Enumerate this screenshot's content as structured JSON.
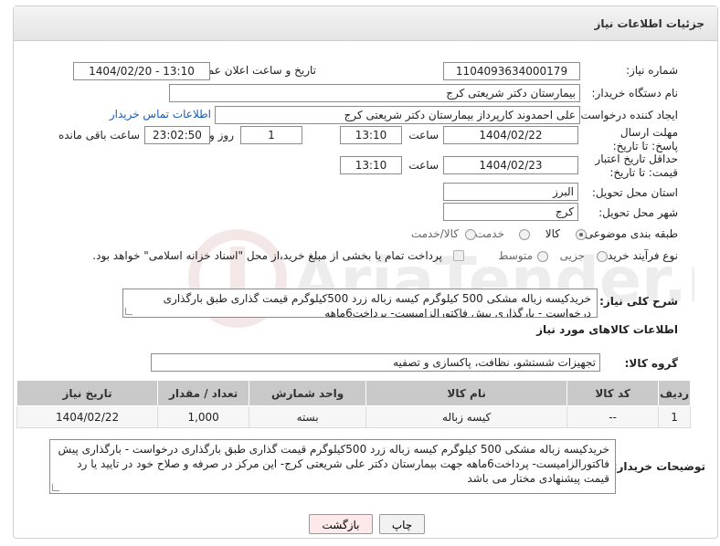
{
  "header": {
    "title": "جزئیات اطلاعات نیاز"
  },
  "form": {
    "need_number_label": "شماره نیاز:",
    "need_number": "1104093634000179",
    "announce_label": "تاریخ و ساعت اعلان عمومی:",
    "announce_value": "1404/02/20 - 13:10",
    "buyer_org_label": "نام دستگاه خریدار:",
    "buyer_org": "بیمارستان دکتر شریعتی کرج",
    "creator_label": "ایجاد کننده درخواست:",
    "creator": "علی احمدوند کارپرداز بیمارستان دکتر شریعتی کرج",
    "contact_link": "اطلاعات تماس خریدار",
    "deadline_label": "مهلت ارسال پاسخ: تا تاریخ:",
    "deadline_date": "1404/02/22",
    "time_label": "ساعت",
    "deadline_time": "13:10",
    "days_value": "1",
    "days_label": "روز و",
    "remaining_value": "23:02:50",
    "remaining_label": "ساعت باقی مانده",
    "validity_label": "حداقل تاریخ اعتبار قیمت: تا تاریخ:",
    "validity_date": "1404/02/23",
    "validity_time": "13:10",
    "province_label": "استان محل تحویل:",
    "province": "البرز",
    "city_label": "شهر محل تحویل:",
    "city": "کرج",
    "category_label": "طبقه بندی موضوعی:",
    "category_options": [
      "کالا",
      "خدمت",
      "کالا/خدمت"
    ],
    "category_selected": "کالا",
    "process_label": "نوع فرآیند خرید :",
    "process_options": [
      "جزیی",
      "متوسط"
    ],
    "process_note": "پرداخت تمام یا بخشی از مبلغ خرید،از محل \"اسناد خزانه اسلامی\" خواهد بود.",
    "summary_label": "شرح کلی نیاز:",
    "summary": "خریدکیسه زباله مشکی 500 کیلوگرم کیسه زباله زرد 500کیلوگرم قیمت گذاری طبق بارگذاری درخواست  - بارگذاری پیش فاکتورالزامیست- پرداخت6ماهه"
  },
  "goods": {
    "section_title": "اطلاعات کالاهای مورد نیاز",
    "group_label": "گروه کالا:",
    "group_value": "تجهیزات شستشو، نظافت، پاکسازی و تصفیه",
    "columns": [
      "ردیف",
      "کد کالا",
      "نام کالا",
      "واحد شمارش",
      "تعداد / مقدار",
      "تاریخ نیاز"
    ],
    "rows": [
      {
        "row": "1",
        "code": "--",
        "name": "کیسه زباله",
        "unit": "بسته",
        "qty": "1,000",
        "date": "1404/02/22"
      }
    ]
  },
  "buyer_notes": {
    "label": "توضیحات خریدار:",
    "text": "خریدکیسه زباله مشکی 500 کیلوگرم کیسه زباله زرد 500کیلوگرم قیمت گذاری طبق بارگذاری درخواست  - بارگذاری پیش فاکتورالزامیست- پرداخت6ماهه جهت بیمارستان دکتر علی شریعتی کرج- این مرکز در صرفه و صلاح خود در تایید یا رد قیمت پیشنهادی مختار می باشد"
  },
  "buttons": {
    "print": "چاپ",
    "back": "بازگشت"
  },
  "watermark": {
    "text": "AriaTender.net"
  },
  "colors": {
    "link": "#1a5cb8",
    "back_button": "#fde9ea",
    "table_header": "#c9c9c9"
  }
}
